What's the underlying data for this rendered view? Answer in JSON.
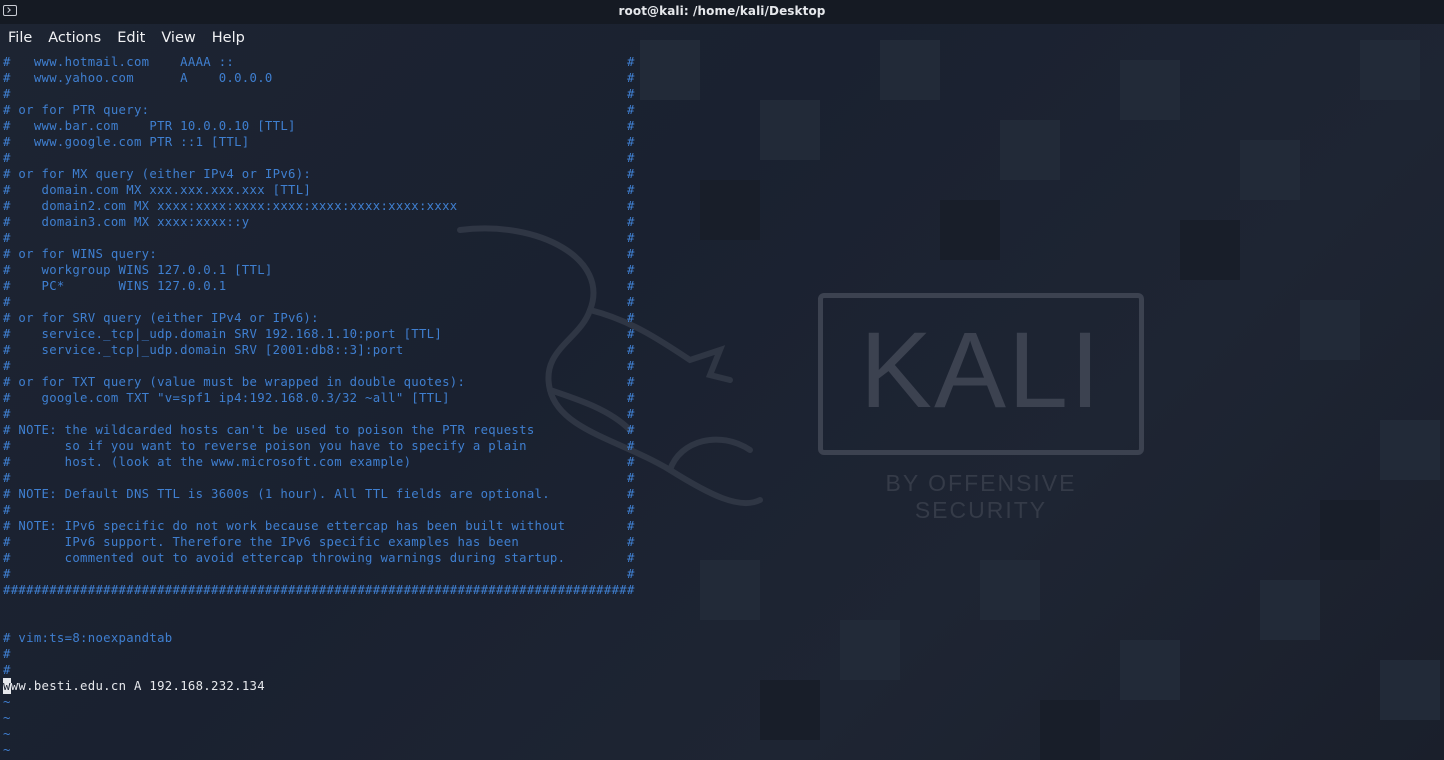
{
  "window": {
    "title": "root@kali: /home/kali/Desktop"
  },
  "menu": {
    "items": [
      "File",
      "Actions",
      "Edit",
      "View",
      "Help"
    ]
  },
  "terminal": {
    "lines": [
      "#   www.hotmail.com    AAAA ::                                                   #",
      "#   www.yahoo.com      A    0.0.0.0                                              #",
      "#                                                                                #",
      "# or for PTR query:                                                              #",
      "#   www.bar.com    PTR 10.0.0.10 [TTL]                                           #",
      "#   www.google.com PTR ::1 [TTL]                                                 #",
      "#                                                                                #",
      "# or for MX query (either IPv4 or IPv6):                                         #",
      "#    domain.com MX xxx.xxx.xxx.xxx [TTL]                                         #",
      "#    domain2.com MX xxxx:xxxx:xxxx:xxxx:xxxx:xxxx:xxxx:xxxx                      #",
      "#    domain3.com MX xxxx:xxxx::y                                                 #",
      "#                                                                                #",
      "# or for WINS query:                                                             #",
      "#    workgroup WINS 127.0.0.1 [TTL]                                              #",
      "#    PC*       WINS 127.0.0.1                                                    #",
      "#                                                                                #",
      "# or for SRV query (either IPv4 or IPv6):                                        #",
      "#    service._tcp|_udp.domain SRV 192.168.1.10:port [TTL]                        #",
      "#    service._tcp|_udp.domain SRV [2001:db8::3]:port                             #",
      "#                                                                                #",
      "# or for TXT query (value must be wrapped in double quotes):                     #",
      "#    google.com TXT \"v=spf1 ip4:192.168.0.3/32 ~all\" [TTL]                       #",
      "#                                                                                #",
      "# NOTE: the wildcarded hosts can't be used to poison the PTR requests            #",
      "#       so if you want to reverse poison you have to specify a plain             #",
      "#       host. (look at the www.microsoft.com example)                            #",
      "#                                                                                #",
      "# NOTE: Default DNS TTL is 3600s (1 hour). All TTL fields are optional.          #",
      "#                                                                                #",
      "# NOTE: IPv6 specific do not work because ettercap has been built without        #",
      "#       IPv6 support. Therefore the IPv6 specific examples has been              #",
      "#       commented out to avoid ettercap throwing warnings during startup.        #",
      "#                                                                                #",
      "##################################################################################",
      "",
      "",
      "# vim:ts=8:noexpandtab",
      "#",
      "#"
    ],
    "cursor_char": "w",
    "entry_rest": "ww.besti.edu.cn A 192.168.232.134",
    "tildes": [
      "~",
      "~",
      "~",
      "~"
    ]
  },
  "logo": {
    "brand": "KALI",
    "tagline": "BY OFFENSIVE SECURITY"
  },
  "colors": {
    "comment": "#3f7fd0",
    "text": "#e6e8ec",
    "background": "#1c2230",
    "logo": "#3c4250"
  }
}
